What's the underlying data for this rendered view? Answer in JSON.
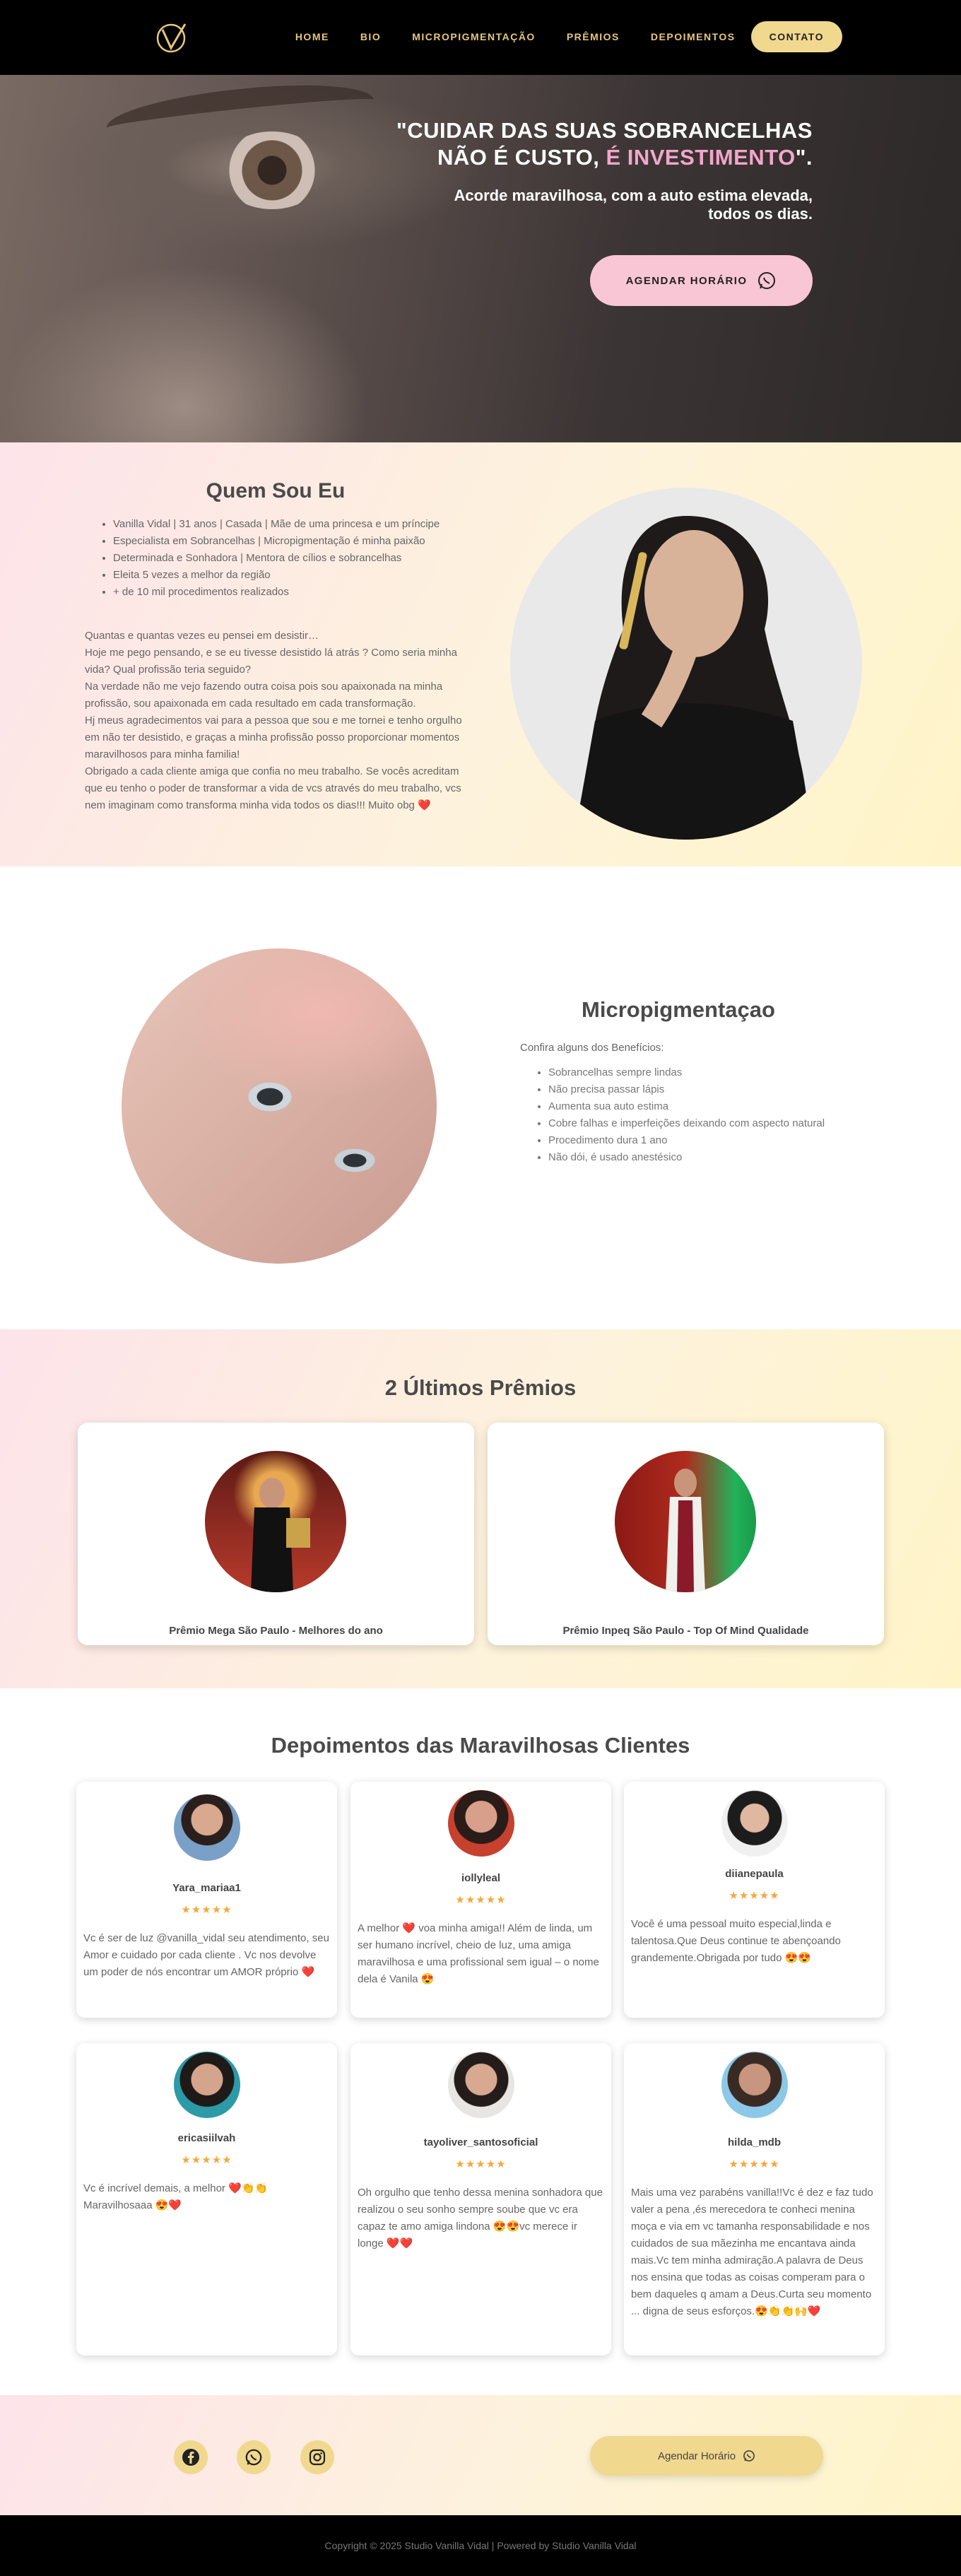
{
  "nav": {
    "items": [
      "HOME",
      "BIO",
      "MICROPIGMENTAÇÃO",
      "PRÊMIOS",
      "DEPOIMENTOS"
    ],
    "contact": "CONTATO",
    "accent": "#e7c67a"
  },
  "hero": {
    "title_line1": "\"CUIDAR DAS SUAS SOBRANCELHAS",
    "title_line2a": "NÃO É CUSTO, ",
    "title_line2b": "É INVESTIMENTO",
    "title_line2c": "\".",
    "subtitle_line1": "Acorde maravilhosa, com a auto estima elevada,",
    "subtitle_line2": "todos os dias.",
    "cta": "AGENDAR HORÁRIO",
    "cta_icon": "whatsapp-icon"
  },
  "about": {
    "title": "Quem Sou Eu",
    "bullets": [
      "Vanilla Vidal | 31 anos | Casada | Mãe de uma princesa e um príncipe",
      "Especialista em Sobrancelhas | Micropigmentação é minha paixão",
      "Determinada e Sonhadora | Mentora de cílios e sobrancelhas",
      "Eleita 5 vezes a melhor da região",
      "+ de 10 mil procedimentos realizados"
    ],
    "bio": "Quantas e quantas vezes eu pensei em desistir…\nHoje me pego pensando, e se eu tivesse desistido lá atrás ? Como seria minha vida? Qual profissão teria seguido?\nNa verdade não me vejo fazendo outra coisa pois sou apaixonada na minha profissão, sou apaixonada em cada resultado em cada transformação.\nHj meus agradecimentos vai para a pessoa que sou e me tornei e tenho orgulho em não ter desistido, e graças a minha profissão posso proporcionar momentos maravilhosos para minha familia!\nObrigado a cada cliente amiga que confia no meu trabalho. Se vocês acreditam que eu tenho o poder de transformar a vida de vcs através do meu trabalho, vcs nem imaginam como transforma minha vida todos os dias!!! Muito obg ❤️"
  },
  "micro": {
    "title": "Micropigmentaçao",
    "intro": "Confira alguns dos Benefícios:",
    "benefits": [
      "Sobrancelhas sempre lindas",
      "Não precisa passar lápis",
      "Aumenta sua auto estima",
      "Cobre falhas e imperfeições deixando com aspecto natural",
      "Procedimento dura 1 ano",
      "Não dói, é usado anestésico"
    ]
  },
  "awards": {
    "title": "2 Últimos Prêmios",
    "items": [
      {
        "caption": "Prêmio Mega São Paulo - Melhores do ano"
      },
      {
        "caption": "Prêmio Inpeq São Paulo - Top Of Mind Qualidade"
      }
    ]
  },
  "testimonials": {
    "title": "Depoimentos das Maravilhosas Clientes",
    "stars": "★★★★★",
    "items": [
      {
        "name": "Yara_mariaa1",
        "text": "Vc é ser de luz @vanilla_vidal seu atendimento, seu Amor e cuidado por cada cliente . Vc nos devolve um poder de nós encontrar um AMOR próprio ❤️"
      },
      {
        "name": "iollyleal",
        "text": "A melhor ❤️ voa minha amiga!! Além de linda, um ser humano incrível, cheio de luz, uma amiga maravilhosa e uma profissional sem igual – o nome dela é Vanila 😍"
      },
      {
        "name": "diianepaula",
        "text": "Você é uma pessoal muito especial,linda e talentosa.Que Deus continue te abençoando grandemente.Obrigada por tudo 😍😍"
      },
      {
        "name": "ericasiilvah",
        "text": "Vc é incrível demais, a melhor ❤️👏👏 Maravilhosaaa 😍❤️"
      },
      {
        "name": "tayoliver_santosoficial",
        "text": "Oh orgulho que tenho dessa menina sonhadora que realizou o seu sonho sempre soube que vc era capaz te amo amiga lindona 😍😍vc merece ir longe ❤️❤️"
      },
      {
        "name": "hilda_mdb",
        "text": "Mais uma vez parabéns vanilla!!Vc é dez e faz tudo valer a pena ,és merecedora te conheci menina moça e via em vc tamanha responsabilidade e nos cuidados de sua mãezinha me encantava ainda mais.Vc tem minha admiração.A palavra de Deus nos ensina que todas as coisas comperam para o bem daqueles q amam a Deus.Curta seu momento ... digna de seus esforços.😍👏👏🙌❤️"
      }
    ]
  },
  "footer": {
    "social_icons": [
      "facebook-icon",
      "whatsapp-icon",
      "instagram-icon"
    ],
    "cta": "Agendar Horário",
    "copyright": "Copyright © 2025 Studio Vanilla Vidal | Powered by Studio Vanilla Vidal"
  }
}
